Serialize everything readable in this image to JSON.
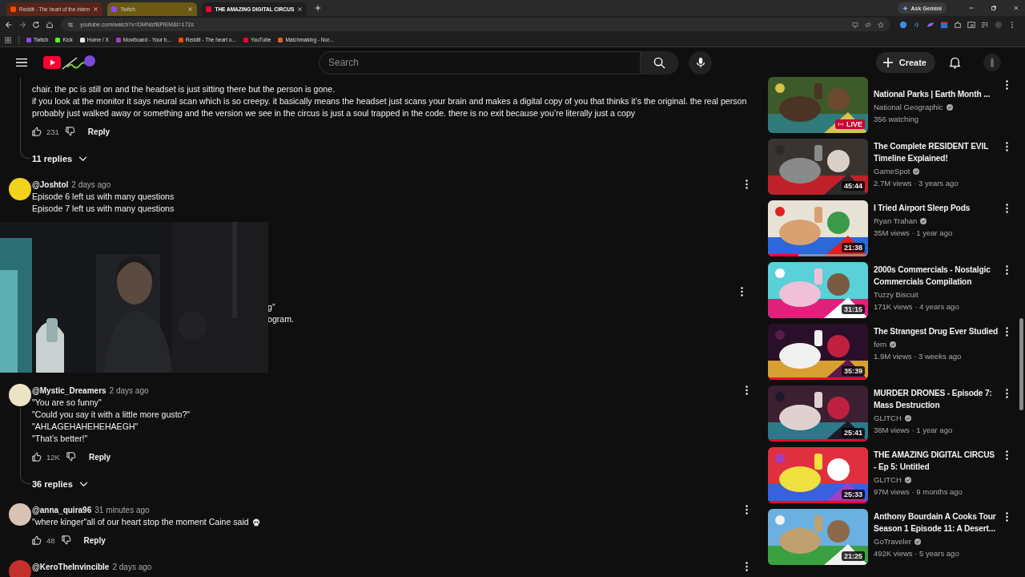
{
  "browser": {
    "tabs": [
      {
        "title": "Reddit - The heart of the intern",
        "selected": false,
        "color": "#5a2418"
      },
      {
        "title": "Twitch",
        "selected": false,
        "color": "#6b5914"
      },
      {
        "title": "THE AMAZING DIGITAL CIRCUS",
        "selected": true
      }
    ],
    "gemini": "Ask Gemini",
    "url": "youtube.com/watch?v=DMNlzfBPiEM&t=172s",
    "bookmarks": [
      "Twitch",
      "Kick",
      "Home / X",
      "Moviboard - Your b...",
      "Reddit - The heart o...",
      "YouTube",
      "Matchmaking - Nor..."
    ]
  },
  "header": {
    "search_placeholder": "Search",
    "create": "Create"
  },
  "comments": [
    {
      "kind": "partial",
      "lines": [
        "chair. the pc is still on and the headset is just sitting there but the person is gone.",
        "if you look at the monitor it says neural scan which is so creepy. it basically means the headset just scans your brain and makes a digital copy of you that thinks it’s the original. the real person probably just walked away or something and the version we see in the circus is just a soul trapped in the code. there is no exit because you’re literally just a copy"
      ],
      "likes": "231",
      "reply": "Reply",
      "replies": "11 replies"
    },
    {
      "kind": "comment",
      "author": "@Joshtol",
      "time": "2 days ago",
      "color": "#f2d21b",
      "lines": [
        "Episode 6 left us with many questions",
        "Episode 7 left us with many questions"
      ]
    },
    {
      "kind": "covered",
      "lines": [
        "g”",
        "ogram."
      ]
    },
    {
      "kind": "comment",
      "author": "@Mystic_Dreamers",
      "time": "2 days ago",
      "color": "#ece3c4",
      "lines": [
        "\"You are so funny\"",
        "\"Could you say it with a little more gusto?\"",
        "\"AHLAGEHAHEHEHAEGH\"",
        "\"That’s better!\""
      ],
      "likes": "12K",
      "reply": "Reply",
      "replies": "36 replies"
    },
    {
      "kind": "comment",
      "author": "@anna_quira96",
      "time": "31 minutes ago",
      "color": "#d9c3b5",
      "lines": [
        "\"where kinger\"all of our heart stop the moment Caine said"
      ],
      "end_icon": true,
      "likes": "48",
      "reply": "Reply"
    },
    {
      "kind": "comment",
      "author": "@KeroTheInvincible",
      "time": "2 days ago",
      "color": "#c4302b"
    }
  ],
  "sidebar": {
    "videos": [
      {
        "kind": "live",
        "title": "National Parks | Earth Month ...",
        "channel": "National Geographic",
        "verified": true,
        "meta": "356 watching",
        "badge": "LIVE"
      },
      {
        "kind": "video",
        "title": "The Complete RESIDENT EVIL Timeline Explained!",
        "channel": "GameSpot",
        "verified": true,
        "meta": "2.7M views · 3 years ago",
        "badge": "45:44"
      },
      {
        "kind": "video",
        "title": "I Tried Airport Sleep Pods",
        "channel": "Ryan Trahan",
        "verified": true,
        "meta": "35M views · 1 year ago",
        "badge": "21:38",
        "level": 0.3
      },
      {
        "kind": "video",
        "title": "2000s Commercials - Nostalgic Commercials Compilation",
        "channel": "Tuzzy Biscuit",
        "verified": false,
        "meta": "171K views · 4 years ago",
        "badge": "31:15"
      },
      {
        "kind": "video",
        "title": "The Strangest Drug Ever Studied",
        "channel": "fern",
        "verified": true,
        "meta": "1.9M views · 3 weeks ago",
        "badge": "35:39",
        "level": 1
      },
      {
        "kind": "video",
        "title": "MURDER DRONES - Episode 7: Mass Destruction",
        "channel": "GLITCH",
        "verified": true,
        "meta": "38M views · 1 year ago",
        "badge": "25:41",
        "level": 1
      },
      {
        "kind": "video",
        "title": "THE AMAZING DIGITAL CIRCUS - Ep 5: Untitled",
        "channel": "GLITCH",
        "verified": true,
        "meta": "97M views · 9 months ago",
        "badge": "25:33",
        "level": 1
      },
      {
        "kind": "video",
        "title": "Anthony Bourdain A Cooks Tour Season 1 Episode 11: A Desert...",
        "channel": "GoTraveler",
        "verified": true,
        "meta": "492K views · 5 years ago",
        "badge": "21:25"
      }
    ]
  }
}
